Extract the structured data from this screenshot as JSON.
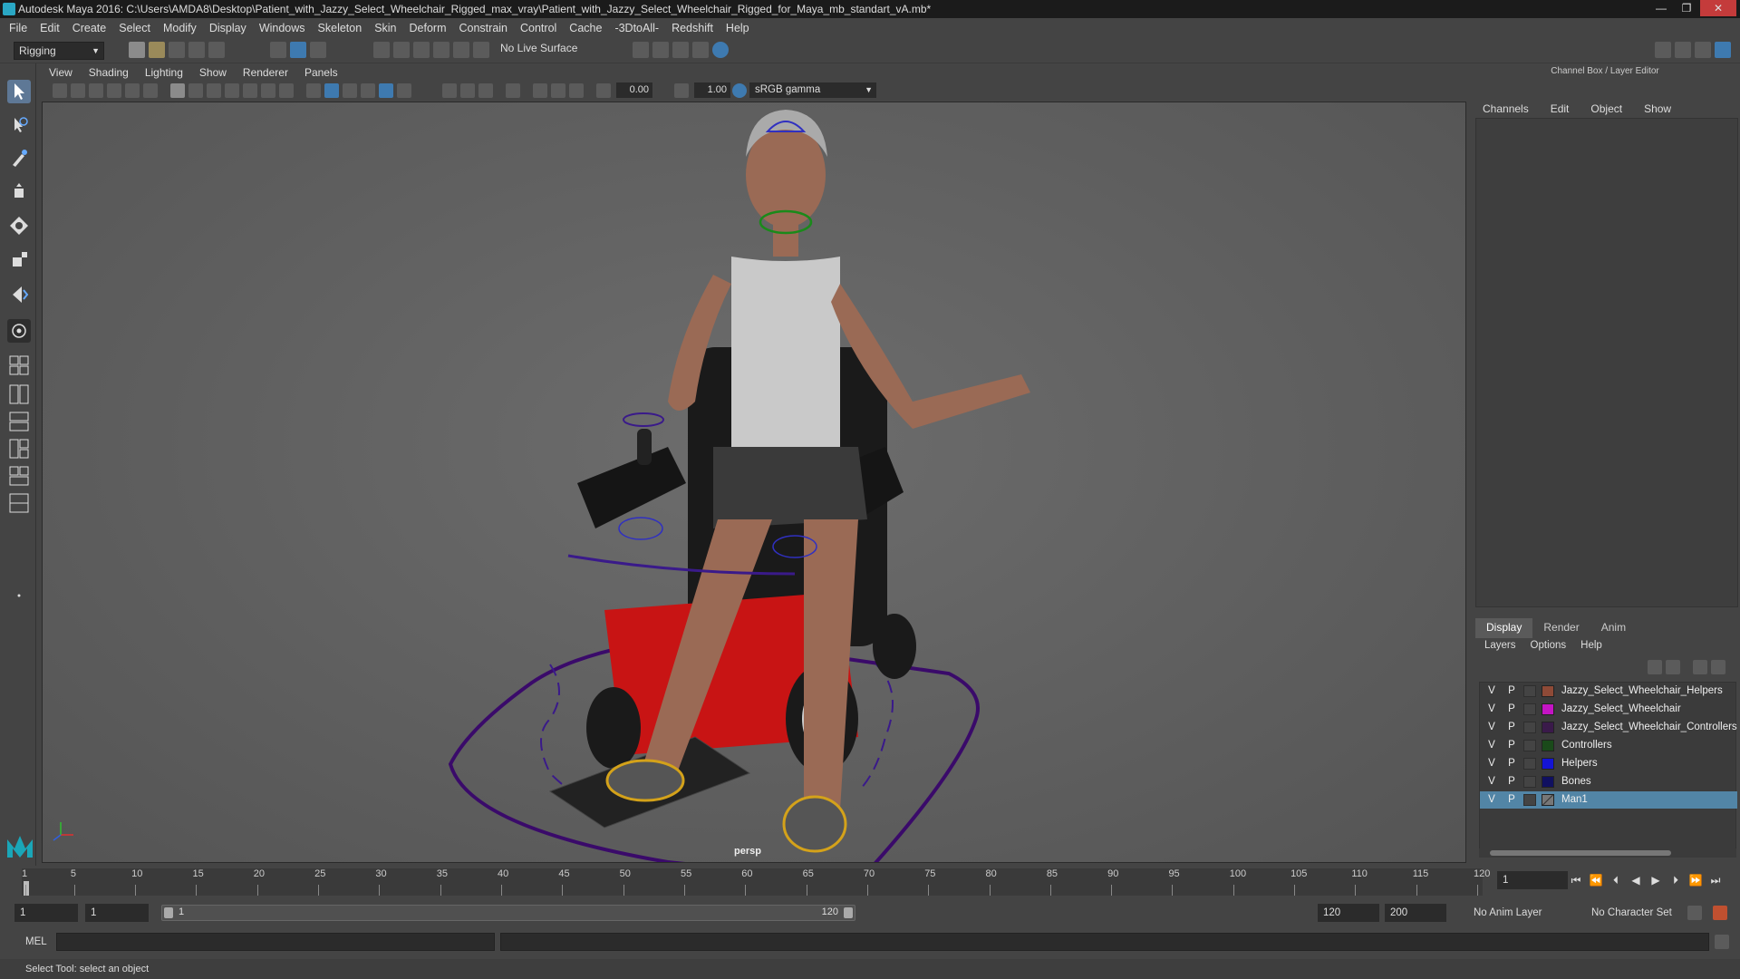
{
  "window": {
    "title": "Autodesk Maya 2016: C:\\Users\\AMDA8\\Desktop\\Patient_with_Jazzy_Select_Wheelchair_Rigged_max_vray\\Patient_with_Jazzy_Select_Wheelchair_Rigged_for_Maya_mb_standart_vA.mb*",
    "minimize": "—",
    "maximize": "❐",
    "close": "✕"
  },
  "menubar": [
    "File",
    "Edit",
    "Create",
    "Select",
    "Modify",
    "Display",
    "Windows",
    "Skeleton",
    "Skin",
    "Deform",
    "Constrain",
    "Control",
    "Cache",
    "-3DtoAll-",
    "Redshift",
    "Help"
  ],
  "shelf": {
    "mode": "Rigging",
    "live_surface": "No Live Surface"
  },
  "viewport": {
    "menu": [
      "View",
      "Shading",
      "Lighting",
      "Show",
      "Renderer",
      "Panels"
    ],
    "exposure": "0.00",
    "gamma": "1.00",
    "color_space": "sRGB gamma",
    "camera_label": "persp"
  },
  "right_panel": {
    "title": "Channel Box / Layer Editor",
    "tabs": [
      "Channels",
      "Edit",
      "Object",
      "Show"
    ],
    "layer_tabs": [
      "Display",
      "Render",
      "Anim"
    ],
    "layer_tab_active": "Display",
    "layer_menu": [
      "Layers",
      "Options",
      "Help"
    ],
    "layers": [
      {
        "v": "V",
        "p": "P",
        "color": "#8e4a37",
        "name": "Jazzy_Select_Wheelchair_Helpers"
      },
      {
        "v": "V",
        "p": "P",
        "color": "#c414c4",
        "name": "Jazzy_Select_Wheelchair"
      },
      {
        "v": "V",
        "p": "P",
        "color": "#3a1a4a",
        "name": "Jazzy_Select_Wheelchair_Controllers"
      },
      {
        "v": "V",
        "p": "P",
        "color": "#1a4a1a",
        "name": "Controllers"
      },
      {
        "v": "V",
        "p": "P",
        "color": "#1414d4",
        "name": "Helpers"
      },
      {
        "v": "V",
        "p": "P",
        "color": "#101060",
        "name": "Bones"
      },
      {
        "v": "V",
        "p": "P",
        "color": "",
        "name": "Man1",
        "selected": true
      }
    ]
  },
  "timeline": {
    "ticks": [
      "1",
      "5",
      "10",
      "15",
      "20",
      "25",
      "30",
      "35",
      "40",
      "45",
      "50",
      "55",
      "60",
      "65",
      "70",
      "75",
      "80",
      "85",
      "90",
      "95",
      "100",
      "105",
      "110",
      "115",
      "120"
    ],
    "current_frame": "1",
    "controls": [
      "⏮",
      "⏪",
      "⏴",
      "◀",
      "▶",
      "⏵",
      "⏩",
      "⏭"
    ]
  },
  "range": {
    "start": "1",
    "anim_start": "1",
    "slider_start": "1",
    "slider_end": "120",
    "anim_end": "120",
    "end": "200",
    "anim_layer": "No Anim Layer",
    "char_set": "No Character Set"
  },
  "command": {
    "label": "MEL",
    "help": "Select Tool: select an object"
  }
}
